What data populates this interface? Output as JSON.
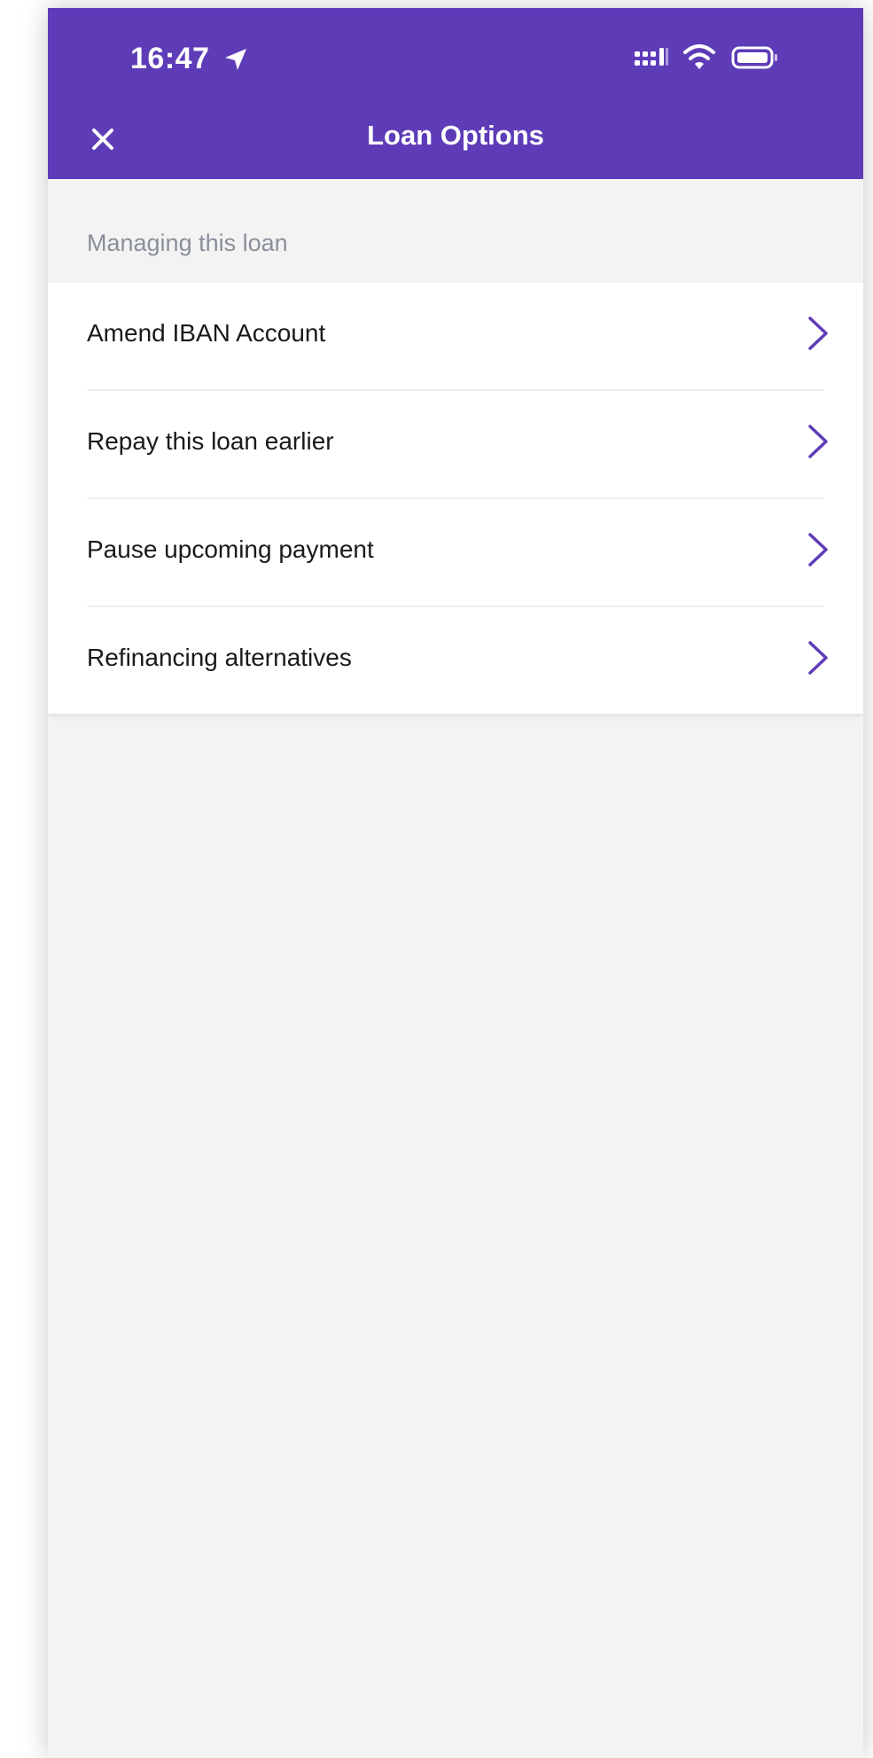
{
  "status_bar": {
    "time": "16:47",
    "icons": [
      "location-arrow-icon",
      "signal-icon",
      "wifi-icon",
      "battery-icon"
    ]
  },
  "header": {
    "title": "Loan Options",
    "close_icon": "close-icon",
    "background_color": "#5e3cb8"
  },
  "section": {
    "title": "Managing this loan"
  },
  "items": [
    {
      "label": "Amend IBAN Account",
      "icon": "chevron-right-icon"
    },
    {
      "label": "Repay this loan earlier",
      "icon": "chevron-right-icon"
    },
    {
      "label": "Pause upcoming payment",
      "icon": "chevron-right-icon"
    },
    {
      "label": "Refinancing alternatives",
      "icon": "chevron-right-icon"
    }
  ],
  "accent_color": "#5e3cb8"
}
